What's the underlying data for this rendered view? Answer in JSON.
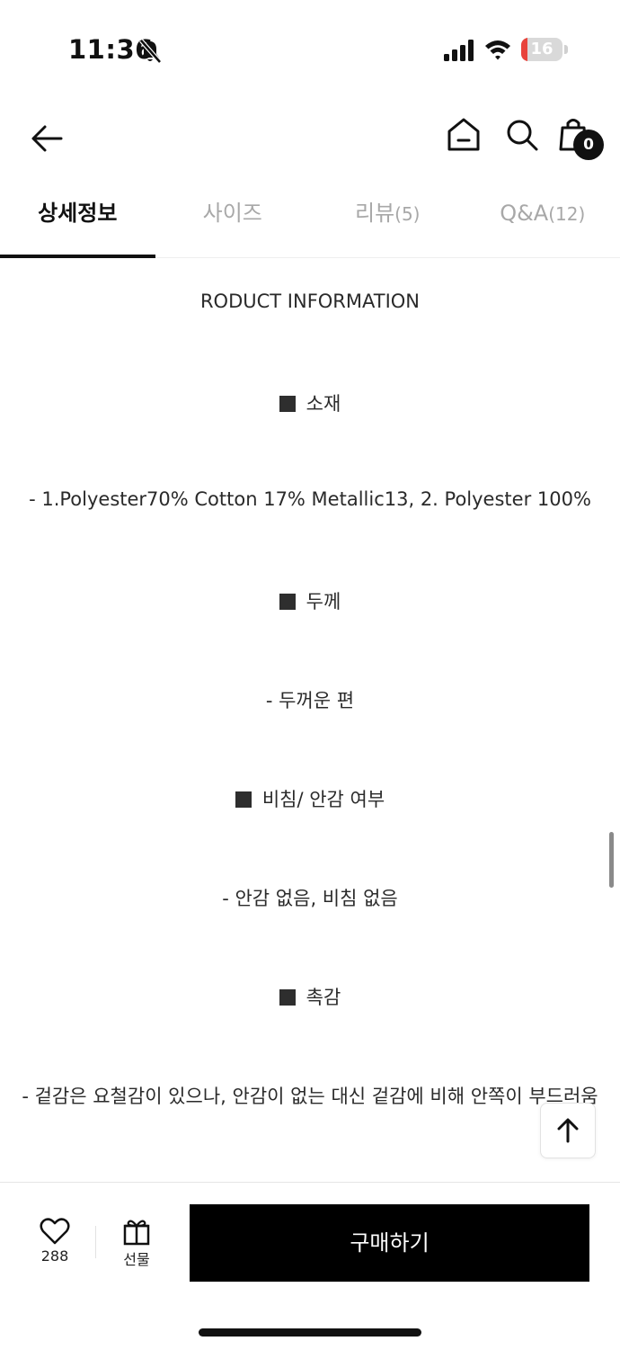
{
  "status_bar": {
    "time": "11:36",
    "battery_level": "16",
    "battery_percent": 16,
    "battery_color": "#e8433b"
  },
  "header": {
    "cart_count": "0"
  },
  "tabs": [
    {
      "label": "상세정보",
      "count": "",
      "active": true
    },
    {
      "label": "사이즈",
      "count": "",
      "active": false
    },
    {
      "label": "리뷰",
      "count": "(5)",
      "active": false
    },
    {
      "label": "Q&A",
      "count": "(12)",
      "active": false
    }
  ],
  "content": {
    "title": "RODUCT INFORMATION",
    "sections": [
      {
        "heading": "소재",
        "text": "- 1.Polyester70% Cotton 17% Metallic13, 2. Polyester 100%"
      },
      {
        "heading": "두께",
        "text": "-  두꺼운 편"
      },
      {
        "heading": "비침/ 안감 여부",
        "text": "-  안감 없음, 비침 없음"
      },
      {
        "heading": "촉감",
        "text": "-  겉감은 요철감이 있으나, 안감이 없는 대신 겉감에 비해 안쪽이 부드러움"
      }
    ]
  },
  "bottom_bar": {
    "like_count": "288",
    "gift_label": "선물",
    "buy_label": "구매하기"
  },
  "icons": {
    "back": "arrow-left-icon",
    "home": "home-icon",
    "search": "search-icon",
    "cart": "shopping-bag-icon",
    "like": "heart-icon",
    "gift": "gift-icon",
    "scroll_top": "arrow-up-icon",
    "mute": "bell-slash-icon"
  }
}
